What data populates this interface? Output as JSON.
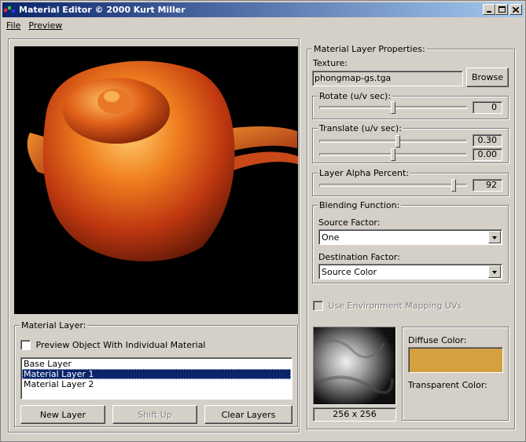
{
  "window": {
    "title": "Material Editor © 2000 Kurt Miller"
  },
  "menu": {
    "file": "File",
    "preview": "Preview"
  },
  "material_layer": {
    "legend": "Material Layer:",
    "preview_checkbox_label": "Preview Object With Individual Material",
    "layers": [
      "Base Layer",
      "Material Layer 1",
      "Material Layer 2"
    ],
    "selected_index": 1,
    "new_layer_label": "New Layer",
    "shift_up_label": "Shift Up",
    "clear_layers_label": "Clear Layers"
  },
  "properties": {
    "legend": "Material Layer Properties:",
    "texture_label": "Texture:",
    "texture_value": "phongmap-gs.tga",
    "browse_label": "Browse",
    "rotate": {
      "legend": "Rotate (u/v sec):",
      "value": "0",
      "slider_fraction": 0.5
    },
    "translate": {
      "legend": "Translate (u/v sec):",
      "u_value": "0.30",
      "v_value": "0.00",
      "u_fraction": 0.53,
      "v_fraction": 0.5
    },
    "alpha": {
      "legend": "Layer Alpha Percent:",
      "value": "92",
      "slider_fraction": 0.91
    },
    "blending": {
      "legend": "Blending Function:",
      "source_label": "Source Factor:",
      "source_value": "One",
      "dest_label": "Destination Factor:",
      "dest_value": "Source Color"
    },
    "env_mapping_label": "Use Environment Mapping UVs",
    "texture_size": "256 x 256",
    "diffuse_label": "Diffuse Color:",
    "diffuse_color": "#d4a040",
    "transparent_label": "Transparent Color:"
  },
  "icons": {
    "title_bar": [
      "minimize-icon",
      "maximize-icon",
      "close-icon"
    ]
  }
}
